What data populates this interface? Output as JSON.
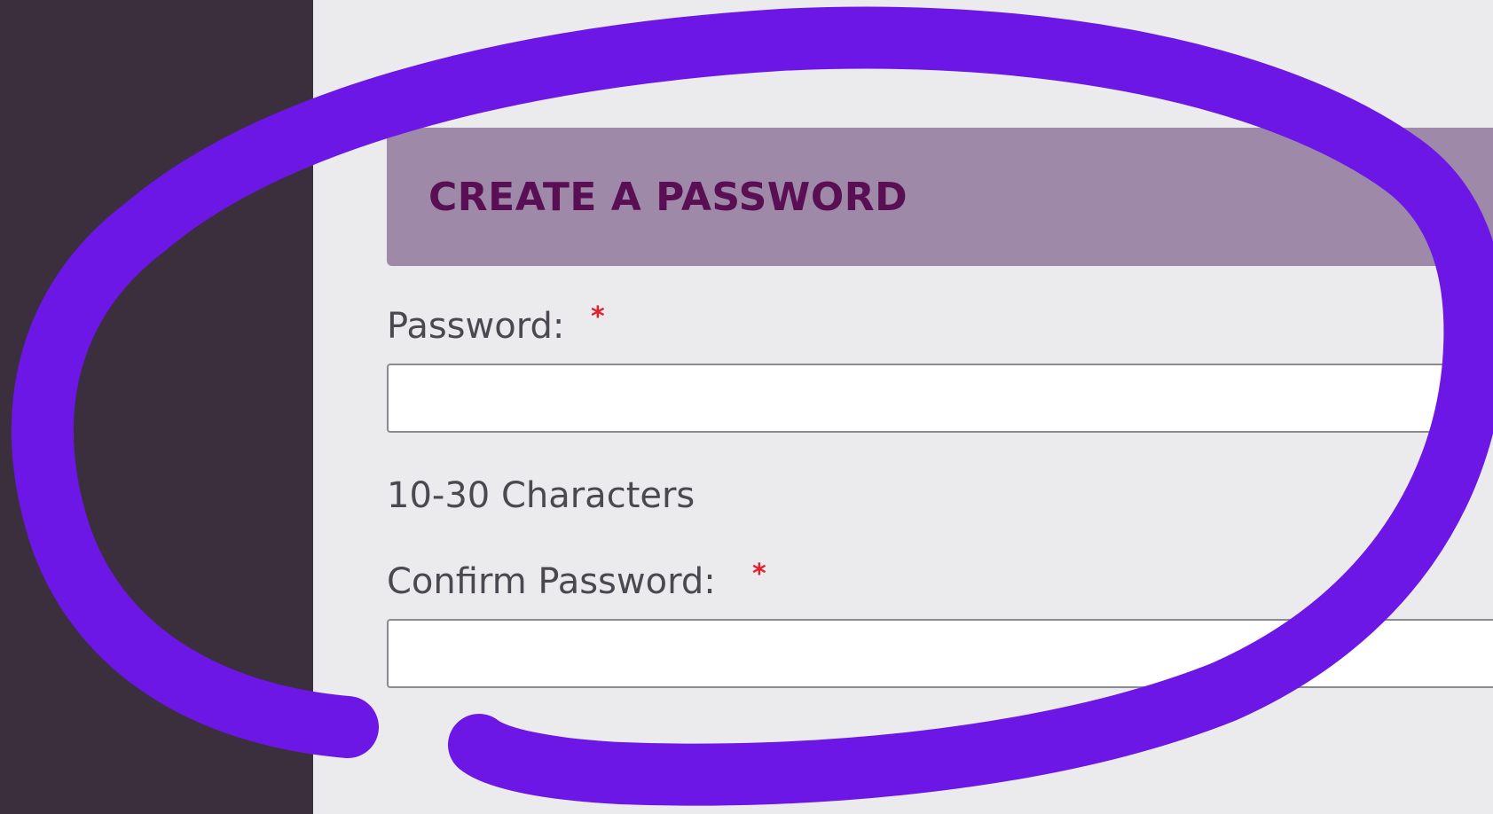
{
  "header": {
    "title": "CREATE A PASSWORD"
  },
  "form": {
    "password": {
      "label": "Password:",
      "required_marker": "*",
      "value": ""
    },
    "hint": "10-30 Characters",
    "confirm_password": {
      "label": "Confirm Password:",
      "required_marker": "*",
      "value": ""
    }
  },
  "colors": {
    "sidebar": "#3c2f3d",
    "page_background": "#ebebee",
    "header_background": "#9e8aa8",
    "header_text": "#5a0f55",
    "required_marker": "#e51e2c",
    "annotation_stroke": "#6c17e6"
  },
  "annotation": {
    "type": "hand-drawn-circle"
  }
}
